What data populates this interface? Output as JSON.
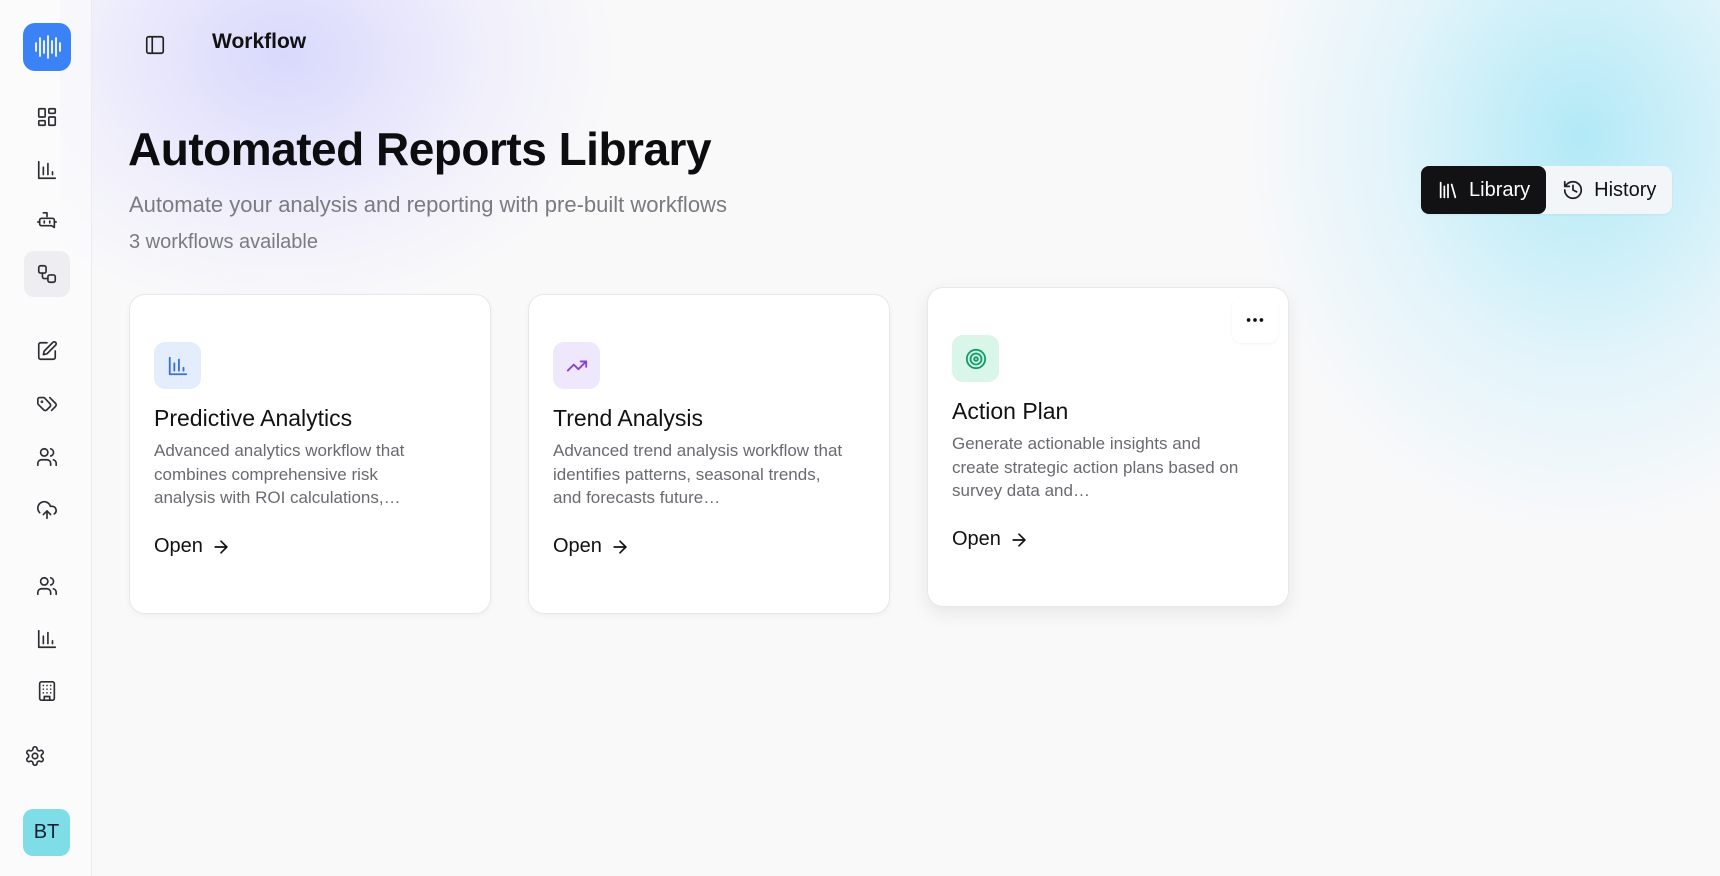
{
  "header": {
    "title": "Workflow"
  },
  "page": {
    "title": "Automated Reports Library",
    "subtitle": "Automate your analysis and reporting with pre-built workflows",
    "count": "3 workflows available"
  },
  "view_toggle": {
    "library_label": "Library",
    "history_label": "History",
    "active": "Library"
  },
  "cards": [
    {
      "title": "Predictive Analytics",
      "description": "Advanced analytics workflow that combines comprehensive risk analysis with ROI calculations,…",
      "open_label": "Open",
      "icon": "bar-chart-icon",
      "icon_bg": "#e3edfc",
      "icon_color": "#3b6fd8"
    },
    {
      "title": "Trend Analysis",
      "description": "Advanced trend analysis workflow that identifies patterns, seasonal trends, and forecasts future…",
      "open_label": "Open",
      "icon": "trending-up-icon",
      "icon_bg": "#efe7fb",
      "icon_color": "#8a3fd6"
    },
    {
      "title": "Action Plan",
      "description": "Generate actionable insights and create strategic action plans based on survey data and…",
      "open_label": "Open",
      "icon": "target-icon",
      "icon_bg": "#d9f6e8",
      "icon_color": "#0f9e6a"
    }
  ],
  "user": {
    "initials": "BT"
  },
  "colors": {
    "logo": "#3b82f6",
    "avatar": "#7fdde8",
    "active_toggle": "#121214"
  }
}
